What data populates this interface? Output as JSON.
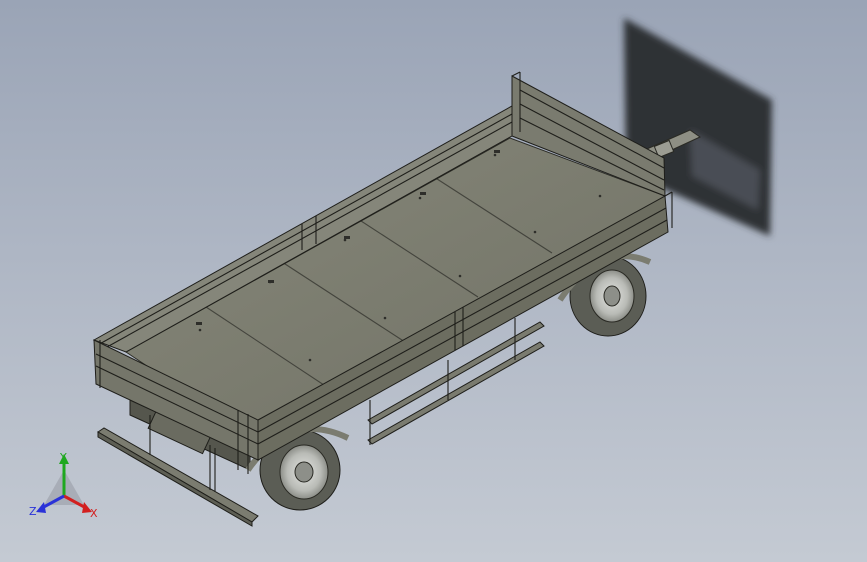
{
  "viewport": {
    "background_top": "#9aa4b6",
    "background_bottom": "#c4cad3"
  },
  "model": {
    "bed_color": "#7b7c6e",
    "side_color": "#6c6d60",
    "tire_color": "#5b5d55",
    "rim_color": "#c9cbc7",
    "blur_panel_color": "#2f3236"
  },
  "triad": {
    "x_label": "X",
    "y_label": "Y",
    "z_label": "Z",
    "x_color": "#d21f1f",
    "y_color": "#1fa81f",
    "z_color": "#2a32d8"
  }
}
